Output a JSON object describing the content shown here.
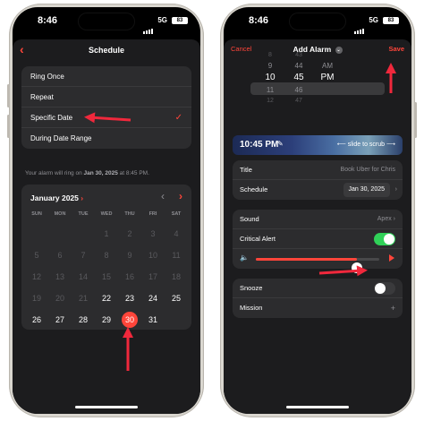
{
  "status": {
    "time": "8:46",
    "network": "5G",
    "battery": "83"
  },
  "left": {
    "nav": {
      "title": "Schedule",
      "back_glyph": "‹"
    },
    "options": [
      {
        "label": "Ring Once",
        "checked": false
      },
      {
        "label": "Repeat",
        "checked": false
      },
      {
        "label": "Specific Date",
        "checked": true
      },
      {
        "label": "During Date Range",
        "checked": false
      }
    ],
    "check_glyph": "✓",
    "note_prefix": "Your alarm will ring on",
    "note_date": "Jan 30, 2025",
    "note_suffix": "at 8:45 PM.",
    "calendar": {
      "month": "January 2025",
      "month_chevron": "›",
      "prev_glyph": "‹",
      "next_glyph": "›",
      "weekdays": [
        "SUN",
        "MON",
        "TUE",
        "WED",
        "THU",
        "FRI",
        "SAT"
      ],
      "days": [
        {
          "d": "",
          "dim": false
        },
        {
          "d": "",
          "dim": false
        },
        {
          "d": "",
          "dim": false
        },
        {
          "d": "1",
          "dim": true
        },
        {
          "d": "2",
          "dim": true
        },
        {
          "d": "3",
          "dim": true
        },
        {
          "d": "4",
          "dim": true
        },
        {
          "d": "5",
          "dim": true
        },
        {
          "d": "6",
          "dim": true
        },
        {
          "d": "7",
          "dim": true
        },
        {
          "d": "8",
          "dim": true
        },
        {
          "d": "9",
          "dim": true
        },
        {
          "d": "10",
          "dim": true
        },
        {
          "d": "11",
          "dim": true
        },
        {
          "d": "12",
          "dim": true
        },
        {
          "d": "13",
          "dim": true
        },
        {
          "d": "14",
          "dim": true
        },
        {
          "d": "15",
          "dim": true
        },
        {
          "d": "16",
          "dim": true
        },
        {
          "d": "17",
          "dim": true
        },
        {
          "d": "18",
          "dim": true
        },
        {
          "d": "19",
          "dim": true
        },
        {
          "d": "20",
          "dim": true
        },
        {
          "d": "21",
          "dim": true
        },
        {
          "d": "22",
          "dim": false
        },
        {
          "d": "23",
          "dim": false
        },
        {
          "d": "24",
          "dim": false
        },
        {
          "d": "25",
          "dim": false
        },
        {
          "d": "26",
          "dim": false
        },
        {
          "d": "27",
          "dim": false
        },
        {
          "d": "28",
          "dim": false
        },
        {
          "d": "29",
          "dim": false
        },
        {
          "d": "30",
          "dim": false,
          "selected": true
        },
        {
          "d": "31",
          "dim": false
        }
      ]
    }
  },
  "right": {
    "nav": {
      "cancel": "Cancel",
      "title": "Add Alarm",
      "title_glyph": "⌄",
      "save": "Save"
    },
    "picker": {
      "hours": [
        "8",
        "9",
        "10",
        "11",
        "12"
      ],
      "minutes": [
        "43",
        "44",
        "45",
        "46",
        "47"
      ],
      "periods": [
        "",
        "AM",
        "PM",
        "",
        ""
      ]
    },
    "timebar": {
      "time": "10:45 PM",
      "pen_glyph": "✎",
      "scrub": "⟵ slide to scrub ⟶"
    },
    "title_row": {
      "label": "Title",
      "value": "Book Uber for Chris"
    },
    "schedule_row": {
      "label": "Schedule",
      "value": "Jan 30, 2025",
      "chevron": "›"
    },
    "sound_row": {
      "label": "Sound",
      "value": "Apex ›"
    },
    "critical_row": {
      "label": "Critical Alert",
      "on": true
    },
    "volume": {
      "level": 0.82,
      "speaker_glyph": "🔈"
    },
    "snooze_row": {
      "label": "Snooze",
      "on": false
    },
    "mission_row": {
      "label": "Mission",
      "plus": "+"
    }
  },
  "colors": {
    "accent": "#ff453a",
    "toggle_on": "#30d158",
    "background": "#1c1c1e",
    "card": "#2c2c2e"
  }
}
